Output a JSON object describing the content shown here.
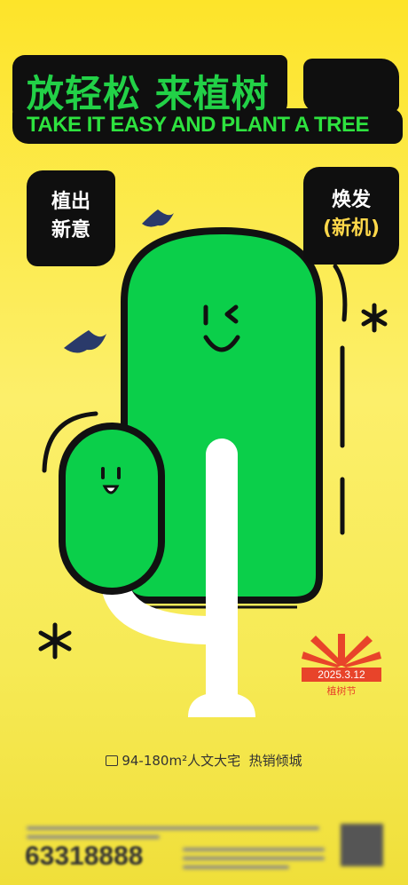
{
  "title": {
    "cn": "放轻松 来植树",
    "en": "TAKE IT EASY AND PLANT A TREE"
  },
  "tags": {
    "left_line1": "植出",
    "left_line2": "新意",
    "right_line1": "焕发",
    "right_line2": "(新机)"
  },
  "event": {
    "date": "2025.3.12",
    "name": "植树节"
  },
  "tagline": {
    "area": "94-180m²人文大宅",
    "slogan": "热销倾城"
  },
  "footer": {
    "phone": "63318888"
  },
  "colors": {
    "background": "#fde42a",
    "green": "#0bcf4a",
    "brand_green_text": "#22d147",
    "black": "#0f0f0f",
    "accent_red": "#e8442a"
  }
}
